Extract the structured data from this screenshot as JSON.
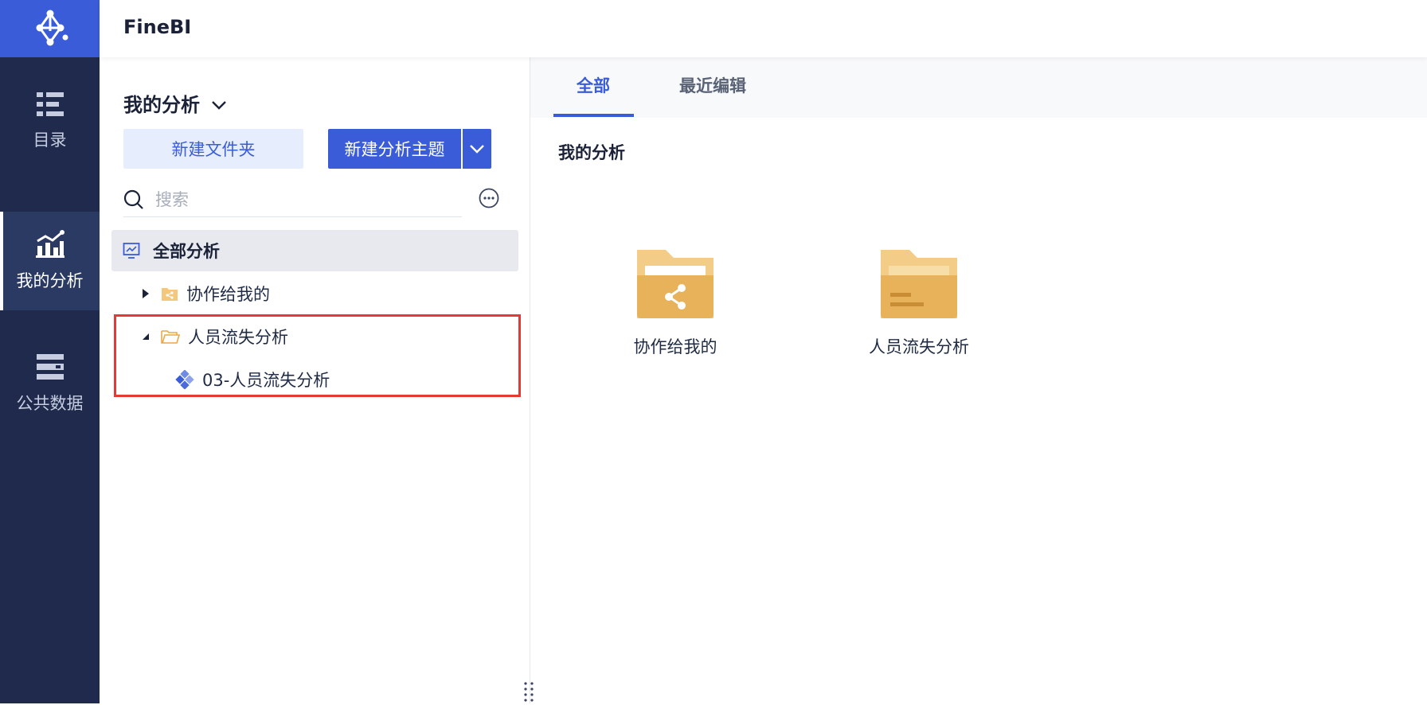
{
  "app": {
    "brand": "FineBI"
  },
  "nav": {
    "items": [
      {
        "label": "目录",
        "icon": "catalog-icon"
      },
      {
        "label": "我的分析",
        "icon": "analysis-chart-icon",
        "active": true
      },
      {
        "label": "公共数据",
        "icon": "public-data-icon"
      }
    ]
  },
  "panel": {
    "title": "我的分析",
    "new_folder_label": "新建文件夹",
    "new_theme_label": "新建分析主题",
    "search_placeholder": "搜索",
    "tree": [
      {
        "label": "全部分析",
        "icon": "dashboard-icon",
        "selected": true
      },
      {
        "label": "协作给我的",
        "icon": "shared-folder-icon",
        "expanded": false
      },
      {
        "label": "人员流失分析",
        "icon": "open-folder-icon",
        "expanded": true
      },
      {
        "label": "03-人员流失分析",
        "icon": "analysis-theme-icon"
      }
    ]
  },
  "main": {
    "tabs": [
      {
        "label": "全部",
        "active": true
      },
      {
        "label": "最近编辑",
        "active": false
      }
    ],
    "section_title": "我的分析",
    "items": [
      {
        "label": "协作给我的",
        "icon": "shared-folder-icon"
      },
      {
        "label": "人员流失分析",
        "icon": "folder-icon"
      }
    ]
  },
  "colors": {
    "accent": "#3a5cd9",
    "nav_bg": "#1f2a4d",
    "folder": "#f0c57a",
    "highlight": "#e53935"
  }
}
